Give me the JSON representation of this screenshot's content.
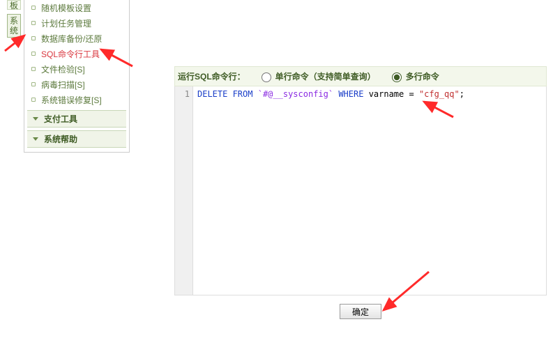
{
  "tabs": {
    "top": "板",
    "system": "系统"
  },
  "sidebar": {
    "items": [
      "随机模板设置",
      "计划任务管理",
      "数据库备份/还原",
      "SQL命令行工具",
      "文件检验[S]",
      "病毒扫描[S]",
      "系统错误修复[S]"
    ],
    "panels": [
      "支付工具",
      "系统帮助"
    ]
  },
  "main": {
    "run_label": "运行SQL命令行：",
    "option_single": "单行命令（支持简单查询）",
    "option_multi": "多行命令",
    "line_no": "1",
    "sql": {
      "kw1": "DELETE FROM",
      "table": "`#@__sysconfig`",
      "kw2": "WHERE",
      "cond_left": "varname = ",
      "cond_str": "\"cfg_qq\"",
      "semi": ";"
    },
    "ok_btn": "确定"
  }
}
